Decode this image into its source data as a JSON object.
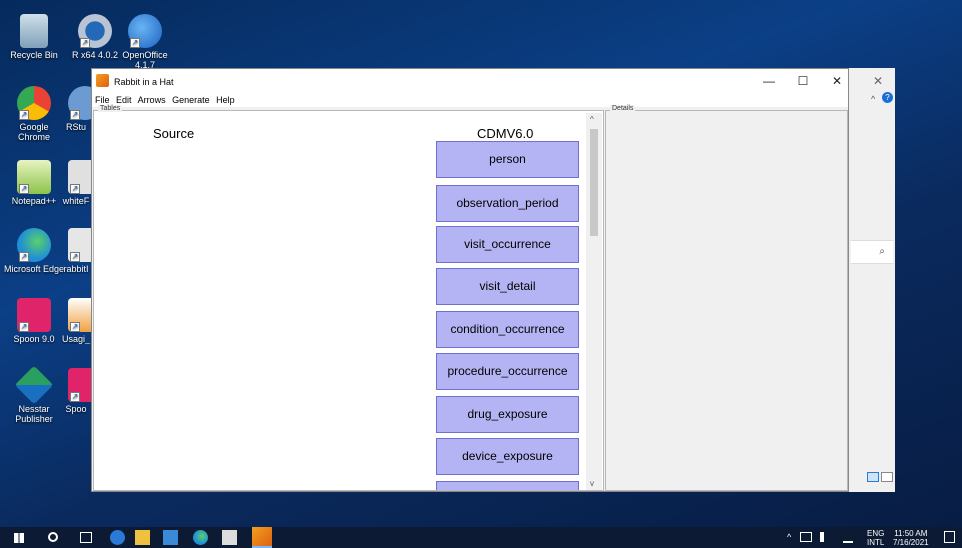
{
  "desktop": {
    "icons": [
      {
        "label": "Recycle Bin",
        "icon": "recycle-bin-icon",
        "color": "#8fb3cc"
      },
      {
        "label": "R x64 4.0.2",
        "icon": "r-icon",
        "color": "#2468b8"
      },
      {
        "label": "OpenOffice 4.1.7",
        "icon": "openoffice-icon",
        "color": "#2d7fd8"
      },
      {
        "label": "Google Chrome",
        "icon": "chrome-icon",
        "color": "#ea4335"
      },
      {
        "label": "RStu",
        "icon": "rstudio-icon",
        "color": "#6c9bd2"
      },
      {
        "label": "Notepad++",
        "icon": "notepadpp-icon",
        "color": "#8bc34a"
      },
      {
        "label": "whiteF",
        "icon": "whiterabbit-icon",
        "color": "#d8d8d8"
      },
      {
        "label": "Microsoft Edge",
        "icon": "edge-icon",
        "color": "#1f8fd6"
      },
      {
        "label": "rabbitI",
        "icon": "rabbitinahat-icon",
        "color": "#dcdcdc"
      },
      {
        "label": "Spoon 9.0",
        "icon": "spoon-icon",
        "color": "#e0246a"
      },
      {
        "label": "Usagi_",
        "icon": "usagi-icon",
        "color": "#f0a040"
      },
      {
        "label": "Nesstar Publisher",
        "icon": "nesstar-icon",
        "color": "#2aa060"
      },
      {
        "label": "Spoo",
        "icon": "spoon-icon-2",
        "color": "#e0246a"
      }
    ]
  },
  "window": {
    "title": "Rabbit in a Hat",
    "min_glyph": "—",
    "max_glyph": "☐",
    "close_glyph": "✕",
    "menu": [
      "File",
      "Edit",
      "Arrows",
      "Generate",
      "Help"
    ]
  },
  "tables_panel": {
    "label": "Tables",
    "source_header": "Source",
    "target_header": "CDMV6.0",
    "target_tables": [
      "person",
      "observation_period",
      "visit_occurrence",
      "visit_detail",
      "condition_occurrence",
      "procedure_occurrence",
      "drug_exposure",
      "device_exposure"
    ],
    "scroll_up": "^",
    "scroll_down": "v"
  },
  "details_panel": {
    "label": "Details"
  },
  "back_window": {
    "close_glyph": "✕",
    "chevron": "^",
    "help": "?",
    "search_icon": "⌕"
  },
  "taskbar": {
    "language": "ENG",
    "language_sub": "INTL",
    "time": "11:50 AM",
    "date": "7/16/2021",
    "tray_chevron": "^"
  },
  "colors": {
    "table_box": "#b4b4f4",
    "table_border": "#7070d0",
    "desktop": "#0b3f86"
  }
}
